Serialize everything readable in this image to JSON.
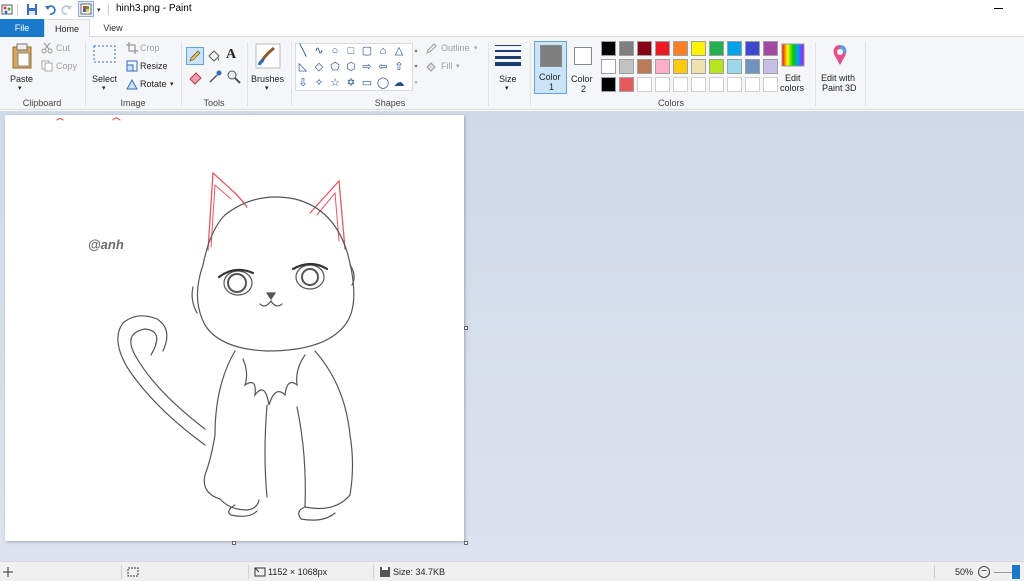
{
  "window": {
    "title": "hinh3.png - Paint"
  },
  "tabs": {
    "file": "File",
    "home": "Home",
    "view": "View"
  },
  "clipboard": {
    "paste": "Paste",
    "cut": "Cut",
    "copy": "Copy",
    "group": "Clipboard"
  },
  "image": {
    "select": "Select",
    "crop": "Crop",
    "resize": "Resize",
    "rotate": "Rotate",
    "group": "Image"
  },
  "tools": {
    "text_glyph": "A",
    "group": "Tools"
  },
  "brushes": {
    "label": "Brushes"
  },
  "shapes": {
    "outline": "Outline",
    "fill": "Fill",
    "group": "Shapes"
  },
  "size": {
    "label": "Size"
  },
  "colors": {
    "color1_label": "Color",
    "color1_num": "1",
    "color2_label": "Color",
    "color2_num": "2",
    "edit_colors_1": "Edit",
    "edit_colors_2": "colors",
    "paint3d_1": "Edit with",
    "paint3d_2": "Paint 3D",
    "group": "Colors",
    "color1_value": "#7f7f7f",
    "color2_value": "#ffffff",
    "palette": [
      [
        "#000000",
        "#7f7f7f",
        "#880015",
        "#ed1c24",
        "#ff7f27",
        "#fff200",
        "#22b14c",
        "#00a2e8",
        "#3f48cc",
        "#a349a4"
      ],
      [
        "#ffffff",
        "#c3c3c3",
        "#b97a57",
        "#ffaec9",
        "#ffc90e",
        "#efe4b0",
        "#b5e61d",
        "#99d9ea",
        "#7092be",
        "#c8bfe7"
      ],
      [
        "#000000",
        "#e8595e",
        "",
        "",
        "",
        "",
        "",
        "",
        "",
        ""
      ]
    ]
  },
  "canvas": {
    "watermark": "@anh"
  },
  "status": {
    "dimensions": "1152 × 1068px",
    "size": "Size: 34.7KB",
    "zoom": "50%"
  }
}
